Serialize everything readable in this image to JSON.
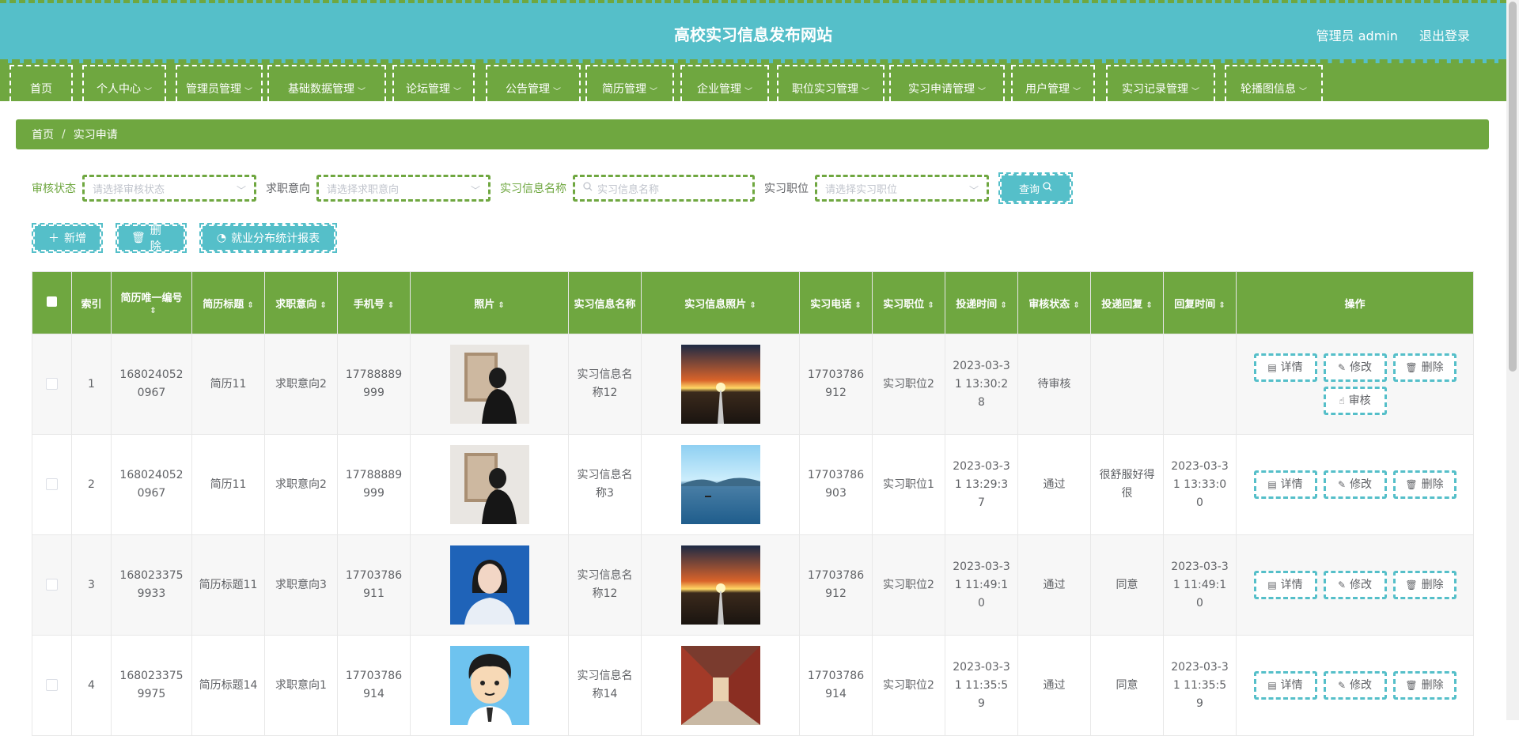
{
  "header": {
    "title": "高校实习信息发布网站",
    "user": "管理员 admin",
    "logout": "退出登录"
  },
  "nav": [
    {
      "label": "首页",
      "dropdown": false
    },
    {
      "label": "个人中心",
      "dropdown": true
    },
    {
      "label": "管理员管理",
      "dropdown": true
    },
    {
      "label": "基础数据管理",
      "dropdown": true
    },
    {
      "label": "论坛管理",
      "dropdown": true
    },
    {
      "label": "公告管理",
      "dropdown": true
    },
    {
      "label": "简历管理",
      "dropdown": true
    },
    {
      "label": "企业管理",
      "dropdown": true
    },
    {
      "label": "职位实习管理",
      "dropdown": true
    },
    {
      "label": "实习申请管理",
      "dropdown": true
    },
    {
      "label": "用户管理",
      "dropdown": true
    },
    {
      "label": "实习记录管理",
      "dropdown": true
    },
    {
      "label": "轮播图信息",
      "dropdown": true
    }
  ],
  "breadcrumb": {
    "home": "首页",
    "sep": "/",
    "current": "实习申请"
  },
  "search": {
    "status_label": "审核状态",
    "status_placeholder": "请选择审核状态",
    "intent_label": "求职意向",
    "intent_placeholder": "请选择求职意向",
    "name_label": "实习信息名称",
    "name_placeholder": "实习信息名称",
    "position_label": "实习职位",
    "position_placeholder": "请选择实习职位",
    "query": "查询"
  },
  "actions": {
    "add": "新增",
    "delete": "删除",
    "report": "就业分布统计报表"
  },
  "columns": [
    "索引",
    "简历唯一编号",
    "简历标题",
    "求职意向",
    "手机号",
    "照片",
    "实习信息名称",
    "实习信息照片",
    "实习电话",
    "实习职位",
    "投递时间",
    "审核状态",
    "投递回复",
    "回复时间",
    "操作"
  ],
  "row_ops": {
    "detail": "详情",
    "edit": "修改",
    "delete": "删除",
    "review": "审核"
  },
  "rows": [
    {
      "index": "1",
      "code": "1680240520967",
      "title": "简历11",
      "intent": "求职意向2",
      "phone": "17788889999",
      "photo": "person-back",
      "info_name": "实习信息名称12",
      "info_photo": "sunset-road",
      "tel": "17703786912",
      "position": "实习职位2",
      "time": "2023-03-31 13:30:28",
      "status": "待审核",
      "reply": "",
      "reply_time": "",
      "can_review": true
    },
    {
      "index": "2",
      "code": "1680240520967",
      "title": "简历11",
      "intent": "求职意向2",
      "phone": "17788889999",
      "photo": "person-back",
      "info_name": "实习信息名称3",
      "info_photo": "lake",
      "tel": "17703786903",
      "position": "实习职位1",
      "time": "2023-03-31 13:29:37",
      "status": "通过",
      "reply": "很舒服好得很",
      "reply_time": "2023-03-31 13:33:00",
      "can_review": false
    },
    {
      "index": "3",
      "code": "1680233759933",
      "title": "简历标题11",
      "intent": "求职意向3",
      "phone": "17703786911",
      "photo": "woman-portrait",
      "info_name": "实习信息名称12",
      "info_photo": "sunset-road",
      "tel": "17703786912",
      "position": "实习职位2",
      "time": "2023-03-31 11:49:10",
      "status": "通过",
      "reply": "同意",
      "reply_time": "2023-03-31 11:49:10",
      "can_review": false
    },
    {
      "index": "4",
      "code": "1680233759975",
      "title": "简历标题14",
      "intent": "求职意向1",
      "phone": "17703786914",
      "photo": "cartoon-man",
      "info_name": "实习信息名称14",
      "info_photo": "corridor",
      "tel": "17703786914",
      "position": "实习职位2",
      "time": "2023-03-31 11:35:59",
      "status": "通过",
      "reply": "同意",
      "reply_time": "2023-03-31 11:35:59",
      "can_review": false
    }
  ]
}
